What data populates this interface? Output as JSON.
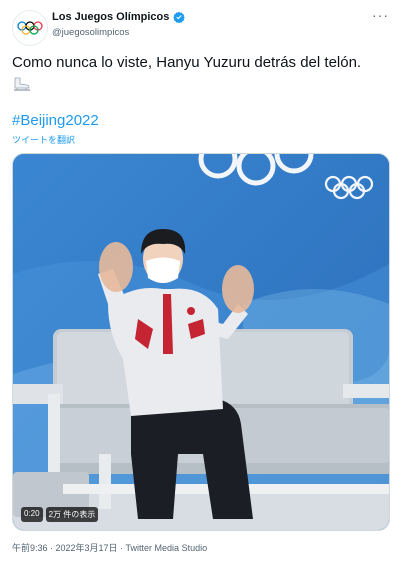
{
  "header": {
    "name": "Los Juegos Olímpicos",
    "handle": "@juegosolimpicos",
    "more_label": "···"
  },
  "tweet": {
    "text": "Como nunca lo viste, Hanyu Yuzuru detrás del telón.",
    "emoji": "ice-skate-emoji",
    "hashtag": "#Beijing2022",
    "translate_label": "ツイートを翻訳"
  },
  "media": {
    "duration": "0:20",
    "views": "2万 件の表示"
  },
  "footer": {
    "meta": "午前9:36 · 2022年3月17日 · Twitter Media Studio"
  },
  "colors": {
    "accent": "#1d9bf0",
    "verified": "#1d9bf0",
    "text": "#0f1419",
    "secondary": "#536471"
  }
}
